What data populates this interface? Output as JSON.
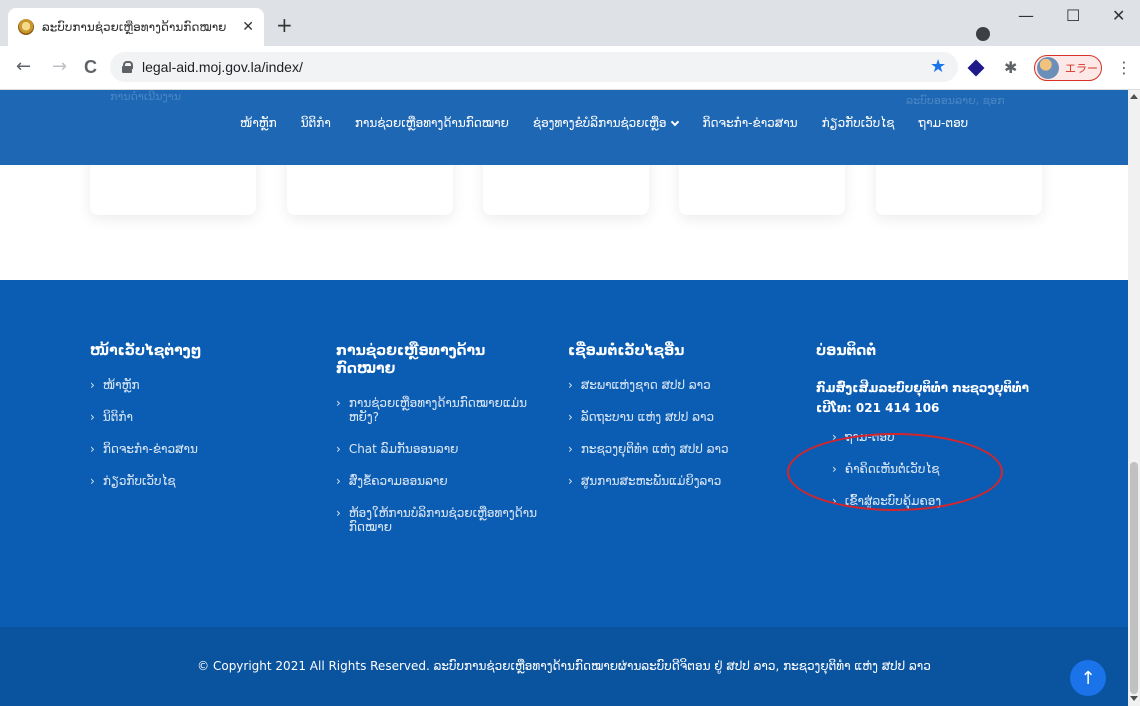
{
  "browser": {
    "tab_title": "ລະບົບການຊ່ວຍເຫຼືອທາງດ້ານກົດໝາຍ",
    "tab_close": "✕",
    "new_tab": "+",
    "url": "legal-aid.moj.gov.la/index/",
    "error_pill": "エラー",
    "win_min": "—",
    "win_max": "☐",
    "win_close": "✕",
    "back": "←",
    "forward": "→",
    "reload": "C",
    "star": "★",
    "puzzle": "✱",
    "menu": "⋮"
  },
  "nav": {
    "items": [
      "ໜ້າຫຼັກ",
      "ນິຕິກຳ",
      "ການຊ່ວຍເຫຼືອທາງດ້ານກົດໝາຍ",
      "ຊ່ອງທາງຂໍບໍລິການຊ່ວຍເຫຼືອ",
      "ກິດຈະກຳ-ຂ່າວສານ",
      "ກ່ຽວກັບເວັບໄຊ",
      "ຖາມ-ຕອບ"
    ],
    "ghost_left": "ການດຳເນີນງານ",
    "ghost_right": "ລະບົບອອນລາຍ, ຊອກ"
  },
  "footer": {
    "col1": {
      "title": "ໜ້າເວັບໄຊຕ່າງໆ",
      "links": [
        "ໜ້າຫຼັກ",
        "ນິຕິກຳ",
        "ກິດຈະກຳ-ຂ່າວສານ",
        "ກ່ຽວກັບເວັບໄຊ"
      ]
    },
    "col2": {
      "title": "ການຊ່ວຍເຫຼືອທາງດ້ານກົດໝາຍ",
      "links": [
        "ການຊ່ວຍເຫຼືອທາງດ້ານກົດໝາຍແມ່ນຫຍັງ?",
        "Chat ລົມກັນອອນລາຍ",
        "ສົ່ງຂໍ້ຄວາມອອນລາຍ",
        "ຫ້ອງໃຫ້ການບໍລິການຊ່ວຍເຫຼືອທາງດ້ານກົດໝາຍ"
      ]
    },
    "col3": {
      "title": "ເຊື່ອມຕໍ່ເວັບໄຊອື່ນ",
      "links": [
        "ສະພາແຫ່ງຊາດ ສປປ ລາວ",
        "ລັດຖະບານ ແຫ່ງ ສປປ ລາວ",
        "ກະຊວງຍຸຕິທຳ ແຫ່ງ ສປປ ລາວ",
        "ສູນການສະຫະພັນແມ່ຍິງລາວ"
      ]
    },
    "col4": {
      "title": "ບ່ອນຕິດຕໍ່",
      "org": "ກົມສົ່ງເສີມລະບົບຍຸຕິທຳ ກະຊວງຍຸຕິທຳ",
      "phone": "ເບີໂທ: 021 414 106",
      "links": [
        "ຖາມ-ຕອບ",
        "ຄຳຄິດເຫັນຕໍ່ເວັບໄຊ",
        "ເຂົ້າສູ່ລະບົບຄຸ້ມຄອງ"
      ]
    }
  },
  "copyright": "© Copyright 2021 All Rights Reserved. ລະບົບການຊ່ວຍເຫຼືອທາງດ້ານກົດໝາຍຜ່ານລະບົບດີຈິຕອນ ຢູ່ ສປປ ລາວ, ກະຊວງຍຸຕິທຳ ແຫ່ງ ສປປ ລາວ",
  "back_to_top": "↑",
  "colors": {
    "nav_bg": "#1d67b4",
    "footer_bg": "#0b5db3",
    "bottom_bg": "#09539f",
    "annotation": "#d4252d"
  }
}
